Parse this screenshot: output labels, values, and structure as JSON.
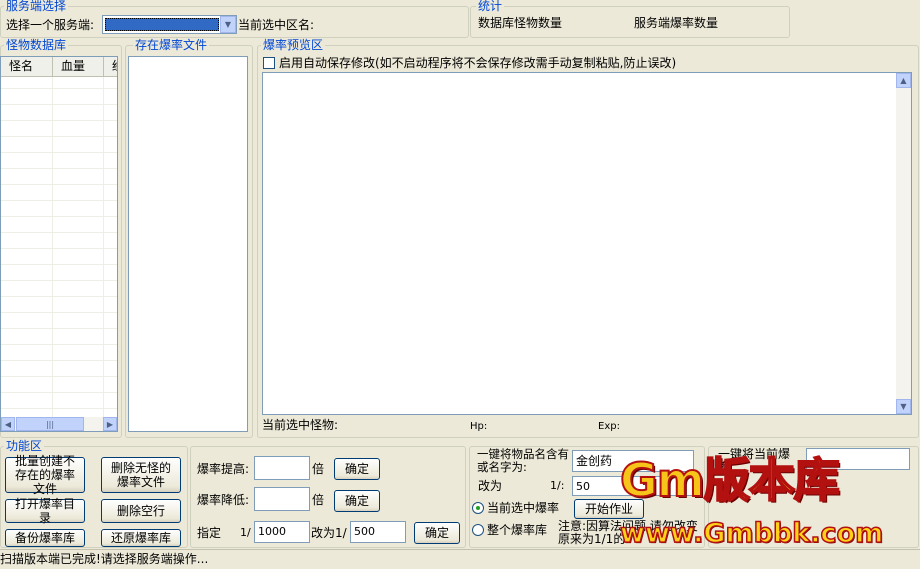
{
  "server": {
    "group_title": "服务端选择",
    "select_label": "选择一个服务端:",
    "select_value": "",
    "current_zone_label": "当前选中区名:"
  },
  "stats": {
    "group_title": "统计",
    "db_monster_count_label": "数据库怪物数量",
    "server_rate_count_label": "服务端爆率数量"
  },
  "monster_db": {
    "group_title": "怪物数据库",
    "columns": [
      "怪名",
      "血量",
      "经"
    ]
  },
  "rate_files": {
    "group_title": "存在爆率文件"
  },
  "preview": {
    "group_title": "爆率预览区",
    "autosave_label": "启用自动保存修改(如不启动程序将不会保存修改需手动复制粘贴,防止误改)",
    "current_monster_label": "当前选中怪物:",
    "hp_label": "Hp:",
    "exp_label": "Exp:"
  },
  "functions": {
    "group_title": "功能区",
    "batch_create": "批量创建不存在的爆率文件",
    "delete_no_monster": "删除无怪的爆率文件",
    "open_rate_dir": "打开爆率目录",
    "delete_empty": "删除空行",
    "backup": "备份爆率库",
    "restore": "还原爆率库"
  },
  "rate_adjust": {
    "raise_label": "爆率提高:",
    "raise_value": "",
    "lower_label": "爆率降低:",
    "lower_value": "",
    "times": "倍",
    "confirm": "确定",
    "specify_label": "指定",
    "one_over": "1/",
    "specify_value": "1000",
    "change_to": "改为1/",
    "change_value": "500"
  },
  "replace": {
    "label": "一键将物品名含有或名字为:",
    "item_value": "金创药",
    "change_to": "改为",
    "one_over": "1/:",
    "rate_value": "50",
    "radio_current": "当前选中爆率",
    "radio_all": "整个爆率库",
    "start_button": "开始作业",
    "note": "注意:因算法问题,请勿改变原来为1/1的",
    "right_label": "一键将当前爆率"
  },
  "status_bar": {
    "text": "扫描版本端已完成!请选择服务端操作..."
  },
  "watermark": {
    "line1": "Gm版本库",
    "line2": "www.Gmbbk.com"
  },
  "colors": {
    "group_title": "#0046d5",
    "background": "#ece9d8",
    "selection": "#316ac5"
  }
}
